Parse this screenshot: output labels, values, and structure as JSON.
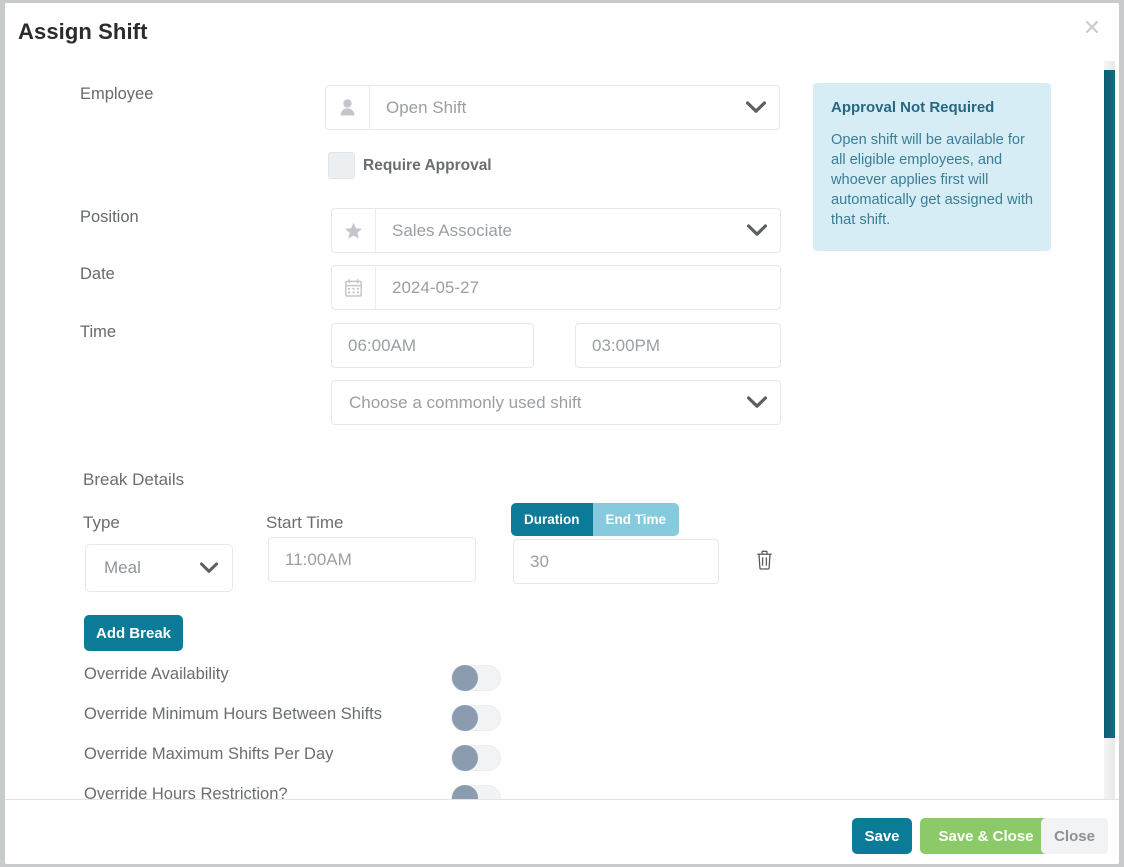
{
  "modal": {
    "title": "Assign Shift",
    "close_icon": "close-icon"
  },
  "form": {
    "employee": {
      "label": "Employee",
      "icon": "user-icon",
      "value": "Open Shift",
      "caret_icon": "chevron-down-icon"
    },
    "require_approval": {
      "label": "Require Approval",
      "checked": false
    },
    "position": {
      "label": "Position",
      "icon": "star-icon",
      "value": "Sales Associate",
      "caret_icon": "chevron-down-icon"
    },
    "date": {
      "label": "Date",
      "icon": "calendar-icon",
      "value": "2024-05-27"
    },
    "time": {
      "label": "Time",
      "start": "06:00AM",
      "end": "03:00PM"
    },
    "common_shift": {
      "placeholder": "Choose a commonly used shift",
      "caret_icon": "chevron-down-icon"
    }
  },
  "break_details": {
    "section_title": "Break Details",
    "headers": {
      "type": "Type",
      "start_time": "Start Time"
    },
    "rows": [
      {
        "type": "Meal",
        "start_time": "11:00AM",
        "mode_duration": "Duration",
        "mode_end_time": "End Time",
        "active_mode": "Duration",
        "duration_value": "30",
        "delete_icon": "trash-icon"
      }
    ],
    "add_break_label": "Add Break"
  },
  "overrides": [
    {
      "label": "Override Availability",
      "on": false
    },
    {
      "label": "Override Minimum Hours Between Shifts",
      "on": false
    },
    {
      "label": "Override Maximum Shifts Per Day",
      "on": false
    },
    {
      "label": "Override Hours Restriction?",
      "on": false
    }
  ],
  "callout": {
    "title": "Approval Not Required",
    "body": "Open shift will be available for all eligible employees, and whoever applies first will automatically get assigned with that shift."
  },
  "footer": {
    "save": "Save",
    "save_and_close": "Save & Close",
    "close": "Close"
  },
  "colors": {
    "teal": "#0b7b97",
    "teal_dark": "#0d6379",
    "green": "#8cc968",
    "light_teal": "#85cadd",
    "callout_bg": "#d7edf5",
    "callout_title": "#276782",
    "callout_text": "#3b7d96",
    "grey_button": "#f1f3f4",
    "toggle_knob": "#8b9cb0"
  }
}
